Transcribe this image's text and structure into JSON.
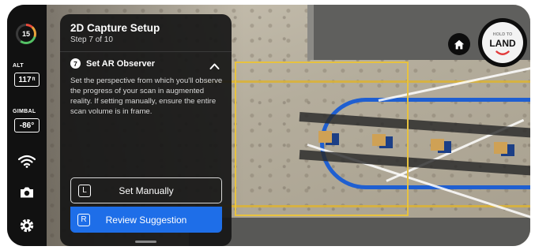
{
  "rail": {
    "battery": "15",
    "alt_label": "ALT",
    "alt_value": "117",
    "alt_unit": "ft",
    "gimbal_label": "GIMBAL",
    "gimbal_value": "-86°"
  },
  "panel": {
    "title": "2D Capture Setup",
    "step": "Step 7 of 10",
    "step_number": "7",
    "step_heading": "Set AR Observer",
    "step_body": "Set the perspective from which you'll observe the progress of your scan in augmented reality. If setting manually, ensure the entire scan volume is in frame.",
    "buttons": [
      {
        "key": "L",
        "label": "Set Manually"
      },
      {
        "key": "R",
        "label": "Review Suggestion"
      }
    ]
  },
  "land_button": {
    "hold_text": "HOLD TO",
    "main_text": "LAND"
  },
  "icons": [
    "battery-icon",
    "wifi-icon",
    "camera-icon",
    "gear-icon",
    "home-icon",
    "chevron-up-icon"
  ],
  "colors": {
    "primary": "#1e6ee8",
    "scan_box": "#e7c23f",
    "path": "#1f5fd1",
    "land_accent": "#e23b3b"
  }
}
